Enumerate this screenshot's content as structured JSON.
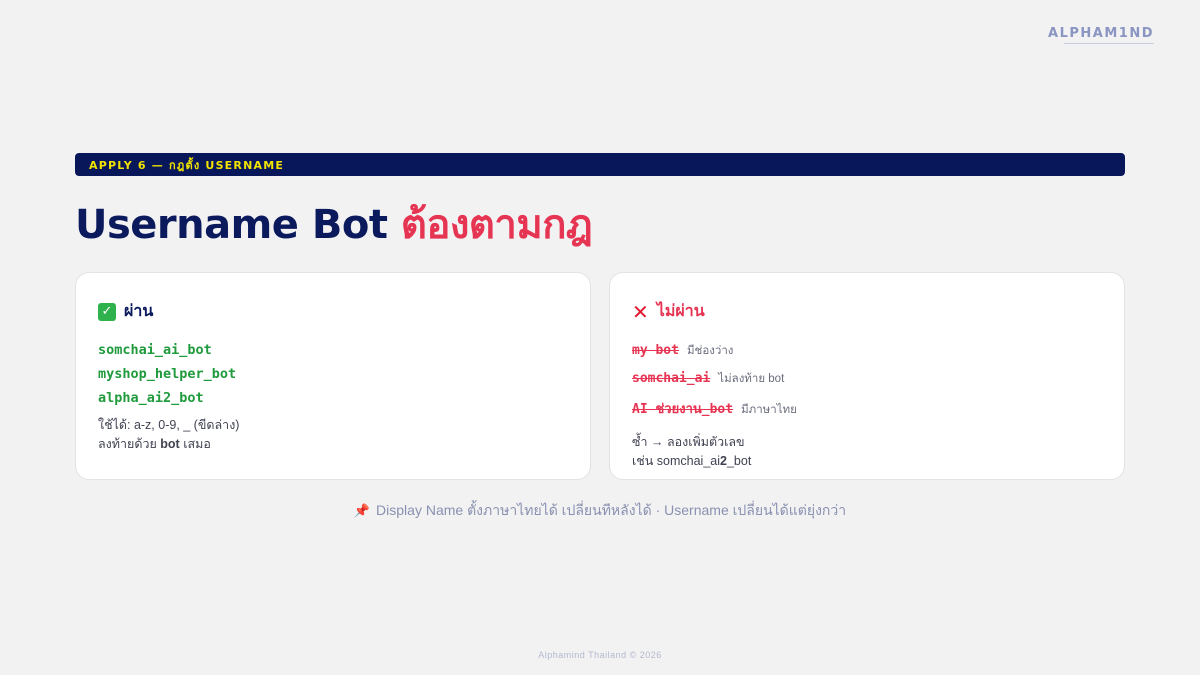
{
  "brand": {
    "logo": "ALPHAM1ND"
  },
  "banner": {
    "text": "APPLY 6 — กฎตั้ง USERNAME"
  },
  "title": {
    "part1": "Username Bot ",
    "part2": "ต้องตามกฎ"
  },
  "pass_card": {
    "icon": "check-icon",
    "heading": "ผ่าน",
    "examples": [
      "somchai_ai_bot",
      "myshop_helper_bot",
      "alpha_ai2_bot"
    ],
    "hint_line1": "ใช้ได้: a-z, 0-9, _ (ขีดล่าง)",
    "hint_line2_prefix": "ลงท้ายด้วย ",
    "hint_line2_bold": "bot",
    "hint_line2_suffix": " เสมอ"
  },
  "fail_card": {
    "icon": "x-icon",
    "heading": "ไม่ผ่าน",
    "examples": [
      {
        "name": "my bot",
        "reason": "มีช่องว่าง"
      },
      {
        "name": "somchai_ai",
        "reason": "ไม่ลงท้าย bot"
      },
      {
        "name": "AI ช่วยงาน_bot",
        "reason": "มีภาษาไทย"
      }
    ],
    "hint_line1": "ซ้ำ → ลองเพิ่มตัวเลข",
    "hint_line2_prefix": "เช่น somchai_ai",
    "hint_line2_bold": "2",
    "hint_line2_suffix": "_bot"
  },
  "note": {
    "icon": "pin-icon",
    "text": "Display Name ตั้งภาษาไทยได้ เปลี่ยนทีหลังได้ · Username เปลี่ยนได้แต่ยุ่งกว่า"
  },
  "footer": {
    "text": "Alphamind Thailand © 2026"
  },
  "colors": {
    "navy": "#07175a",
    "accent_red": "#e63553",
    "pass_green": "#1f9a3c",
    "banner_yellow": "#f3e300"
  }
}
